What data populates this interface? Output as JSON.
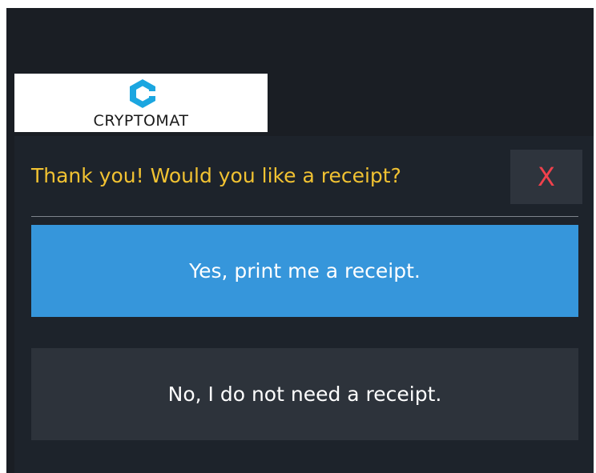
{
  "brand": {
    "name": "CRYPTOMAT",
    "logo_icon": "cryptomat-c-logo",
    "accent_color": "#1ba6e0"
  },
  "dialog": {
    "title": "Thank you! Would you like a receipt?",
    "close_label": "X",
    "title_color": "#f1c232",
    "close_color": "#f0414c"
  },
  "actions": {
    "yes_label": "Yes, print me a receipt.",
    "no_label": "No, I do not need a receipt.",
    "yes_color": "#3696db"
  }
}
